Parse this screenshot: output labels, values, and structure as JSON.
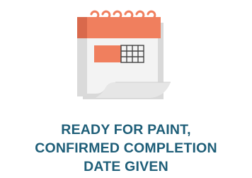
{
  "icon": {
    "name": "calendar-icon",
    "colors": {
      "accent": "#f07f5e",
      "accent_dark": "#c9644a",
      "rings": "#f07f5e",
      "paper": "#f2f2f2",
      "paper_shadow": "#d6d6d6",
      "grid": "#444444"
    }
  },
  "caption": {
    "line1": "READY FOR PAINT,",
    "line2": "CONFIRMED COMPLETION",
    "line3": "DATE GIVEN",
    "color": "#1e5e78"
  }
}
